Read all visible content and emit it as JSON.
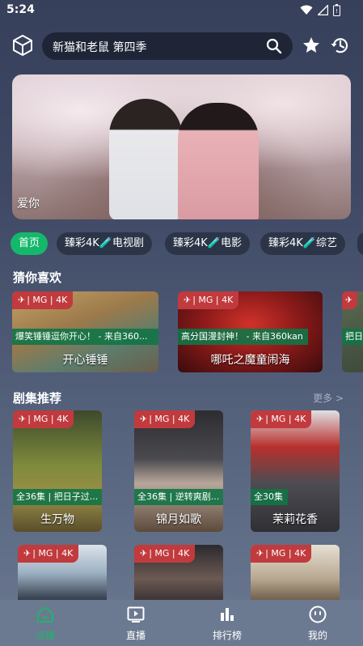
{
  "status_bar": {
    "time": "5:24"
  },
  "search": {
    "text": "新猫和老鼠 第四季"
  },
  "banner": {
    "caption": "爱你"
  },
  "tabs": [
    "首页",
    "臻彩4K🧪电视剧",
    "臻彩4K🧪电影",
    "臻彩4K🧪综艺"
  ],
  "sections": {
    "guess": "猜你喜欢",
    "series": "剧集推荐",
    "more": "更多 >"
  },
  "badge": {
    "plane": "✈",
    "text": "| MG | 4K"
  },
  "guess_cards": [
    {
      "subtitle": "爆笑锤锤逗你开心！ - 来自360...",
      "title": "开心锤锤"
    },
    {
      "subtitle": "高分国漫封神！ - 来自360kan",
      "title": "哪吒之魔童闹海"
    },
    {
      "subtitle": "把日",
      "title": ""
    }
  ],
  "series_cards": [
    {
      "subtitle": "全36集 | 把日子过...",
      "title": "生万物"
    },
    {
      "subtitle": "全36集 | 逆转爽剧...",
      "title": "锦月如歌"
    },
    {
      "subtitle": "全30集",
      "title": "茉莉花香"
    }
  ],
  "nav": [
    {
      "label": "点播",
      "icon": "home-icon",
      "active": true
    },
    {
      "label": "直播",
      "icon": "live-icon",
      "active": false
    },
    {
      "label": "排行榜",
      "icon": "ranking-icon",
      "active": false
    },
    {
      "label": "我的",
      "icon": "profile-icon",
      "active": false
    }
  ],
  "colors": {
    "accent": "#15b86a",
    "badge": "#c13a3d",
    "subtitle_bar": "#127446"
  }
}
